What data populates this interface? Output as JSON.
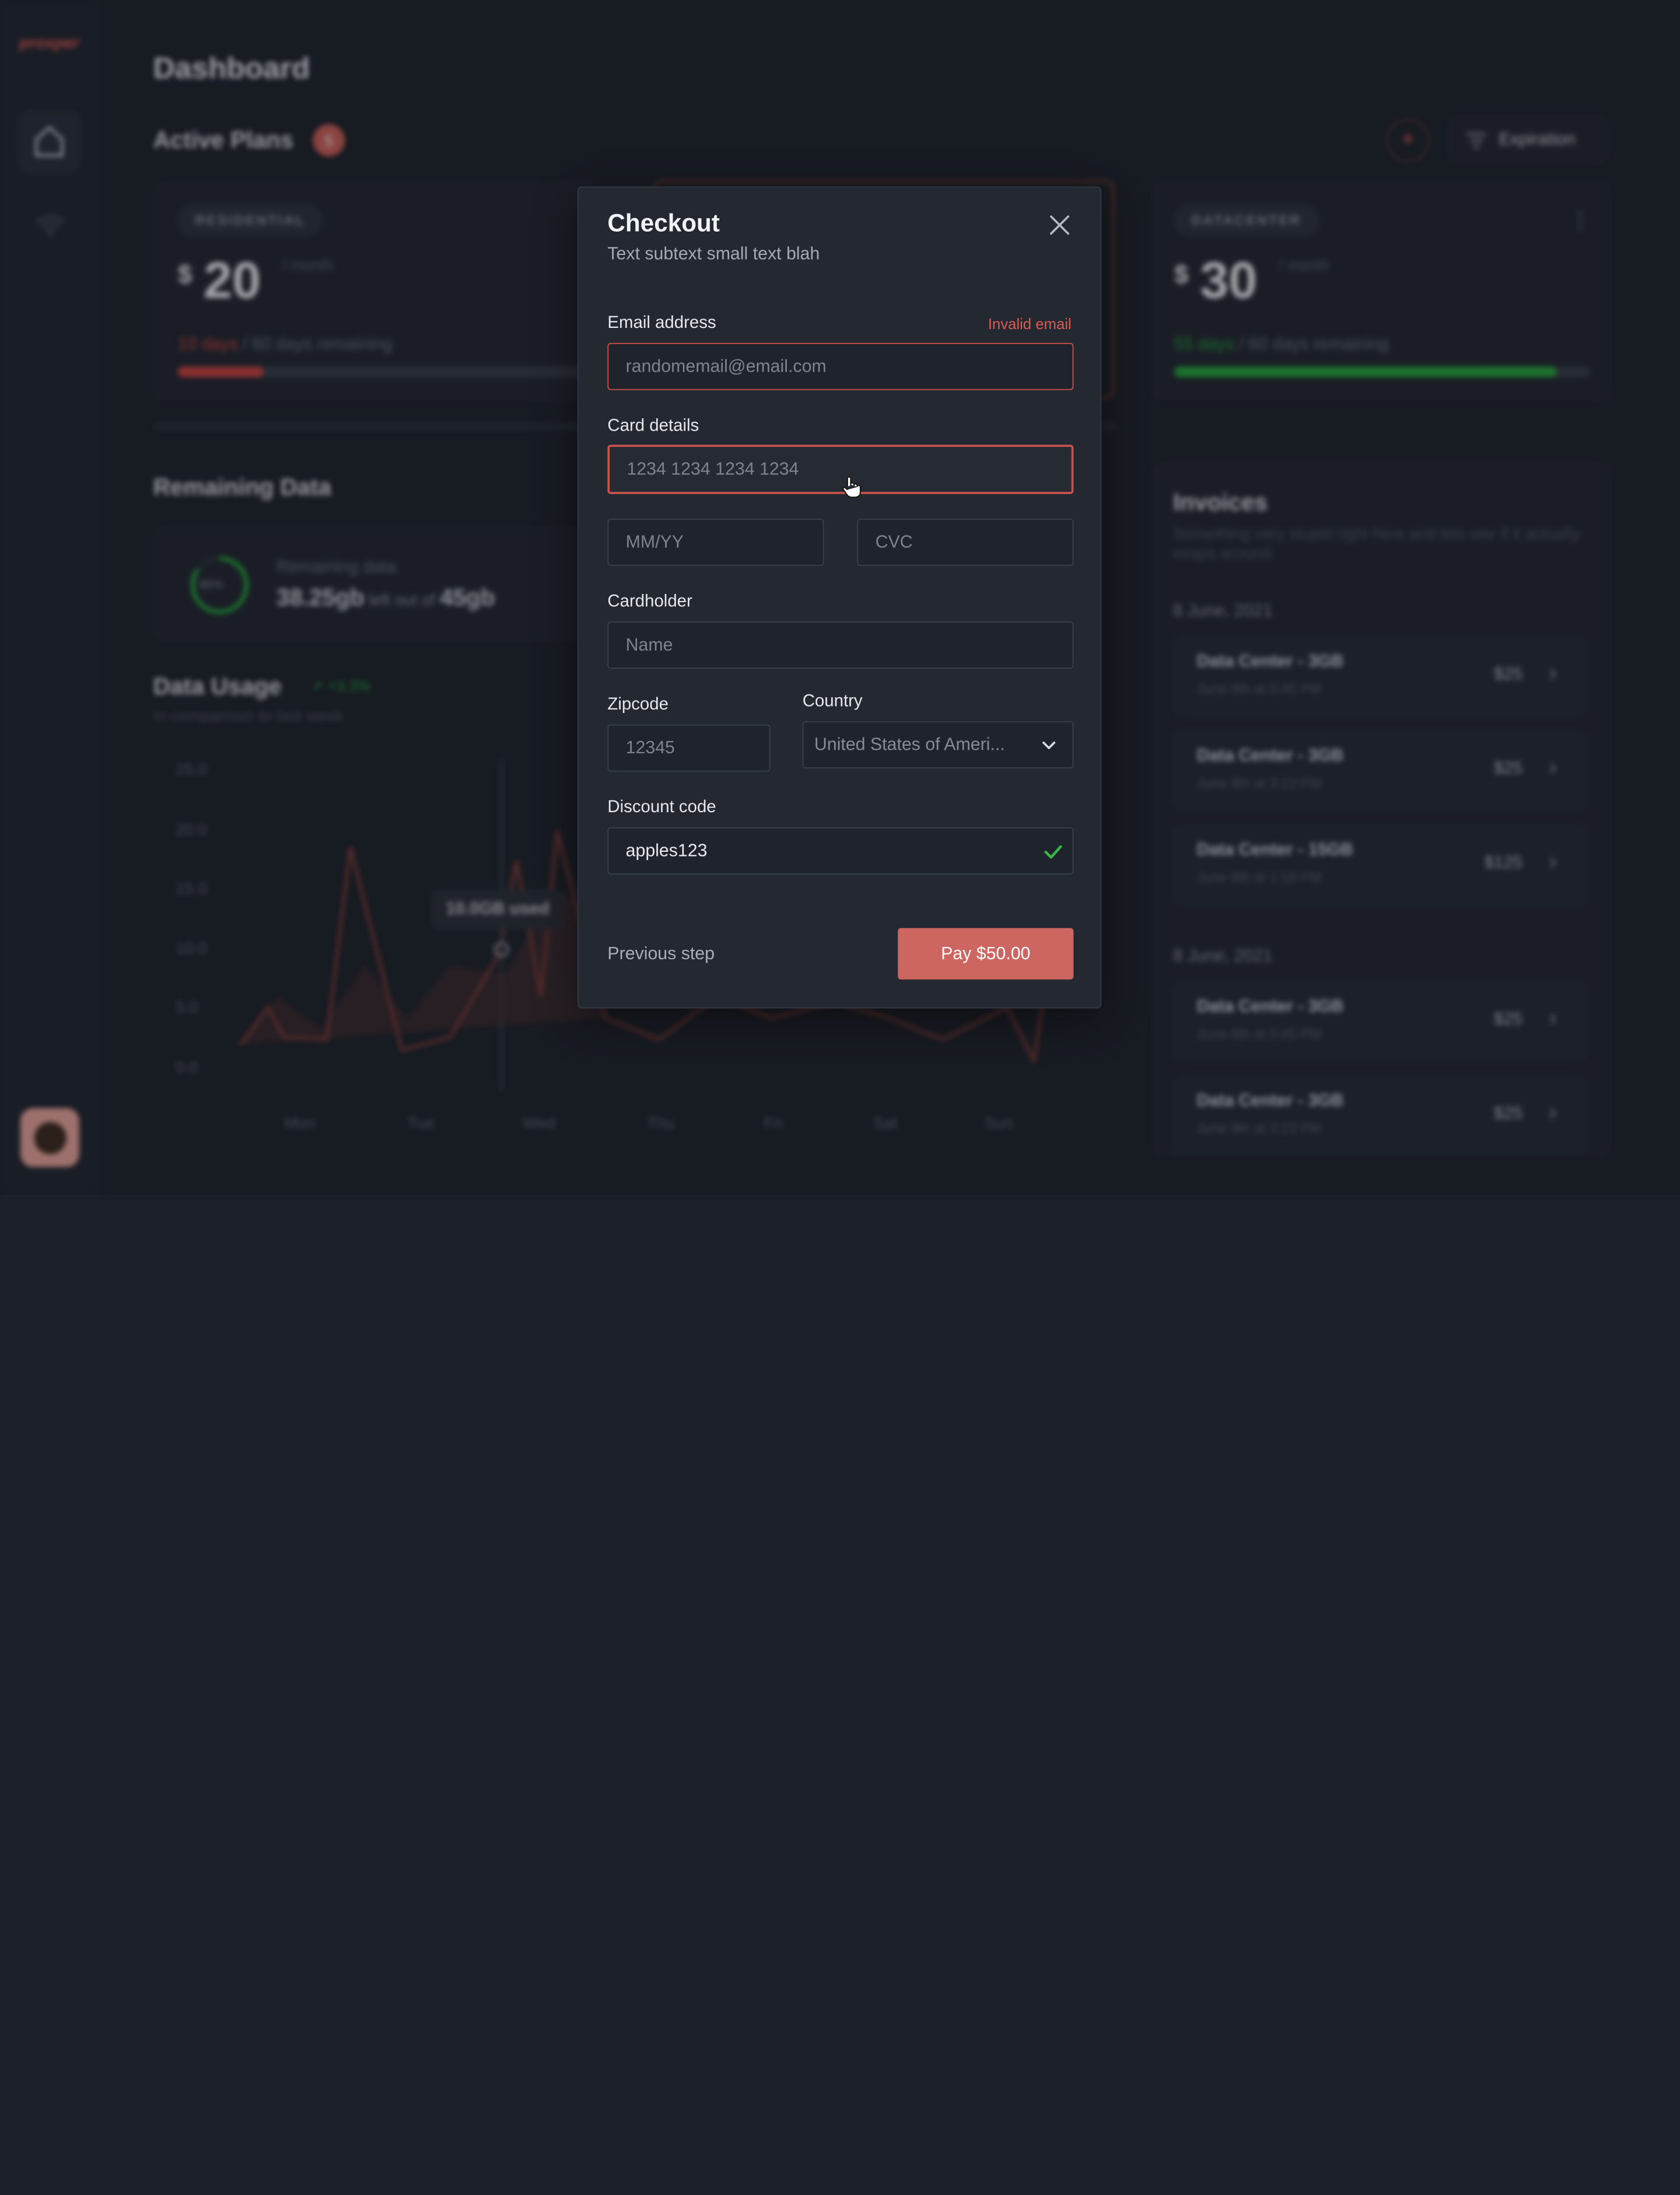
{
  "app": {
    "logo": "proxper"
  },
  "dashboard": {
    "title": "Dashboard",
    "active_plans": {
      "heading": "Active Plans",
      "count": "5",
      "filter_label": "Expiration"
    },
    "plans": [
      {
        "type": "RESIDENTIAL",
        "currency": "$",
        "price": "20",
        "period": "/ month",
        "used_days": "10 days",
        "total": "/ 60 days remaining",
        "progress": 0.2,
        "color": "#c8403b"
      },
      {
        "type": "DATACENTER",
        "currency": "$",
        "price": "30",
        "period": "/ month",
        "used_days": "55 days",
        "total": "/ 60 days remaining",
        "progress": 0.92,
        "color": "#22a23a"
      }
    ],
    "remaining": {
      "heading": "Remaining Data",
      "percent": "85%",
      "label": "Remaining data",
      "amount": "38.25gb",
      "left_of": "left out of",
      "total": "45gb"
    },
    "usage": {
      "heading": "Data Usage",
      "change": "+3.3%",
      "subtitle": "In comparison to last week",
      "tooltip": "10.0GB used",
      "y_ticks": [
        "25.0",
        "20.0",
        "15.0",
        "10.0",
        "5.0",
        "0.0"
      ],
      "x_ticks": [
        "Mon",
        "Tue",
        "Wed",
        "Thu",
        "Fri",
        "Sat",
        "Sun"
      ]
    },
    "invoices": {
      "heading": "Invoices",
      "subtitle": "Something very stupid right here and lets see if it actually wraps around.",
      "groups": [
        {
          "date": "8 June, 2021",
          "items": [
            {
              "title": "Data Center - 3GB",
              "time": "June 8th at 5:45 PM",
              "amount": "$25"
            },
            {
              "title": "Data Center - 3GB",
              "time": "June 8th at 3:23 PM",
              "amount": "$25"
            },
            {
              "title": "Data Center - 15GB",
              "time": "June 8th at 1:18 PM",
              "amount": "$125"
            }
          ]
        },
        {
          "date": "8 June, 2021",
          "items": [
            {
              "title": "Data Center - 3GB",
              "time": "June 8th at 5:45 PM",
              "amount": "$25"
            },
            {
              "title": "Data Center - 3GB",
              "time": "June 8th at 3:23 PM",
              "amount": "$25"
            }
          ]
        }
      ]
    }
  },
  "checkout": {
    "title": "Checkout",
    "subtitle": "Text subtext small text blah",
    "email": {
      "label": "Email address",
      "error": "Invalid email",
      "value": "",
      "placeholder": "randomemail@email.com"
    },
    "card": {
      "label": "Card details",
      "number_placeholder": "1234 1234 1234 1234",
      "expiry_placeholder": "MM/YY",
      "cvc_placeholder": "CVC"
    },
    "cardholder": {
      "label": "Cardholder",
      "placeholder": "Name"
    },
    "zipcode": {
      "label": "Zipcode",
      "placeholder": "12345"
    },
    "country": {
      "label": "Country",
      "selected": "United States of Ameri..."
    },
    "discount": {
      "label": "Discount code",
      "value": "apples123"
    },
    "previous_label": "Previous step",
    "pay_label": "Pay $50.00",
    "accent": "#cd6560",
    "error_color": "#dc5a54",
    "success_color": "#3bb54a"
  }
}
